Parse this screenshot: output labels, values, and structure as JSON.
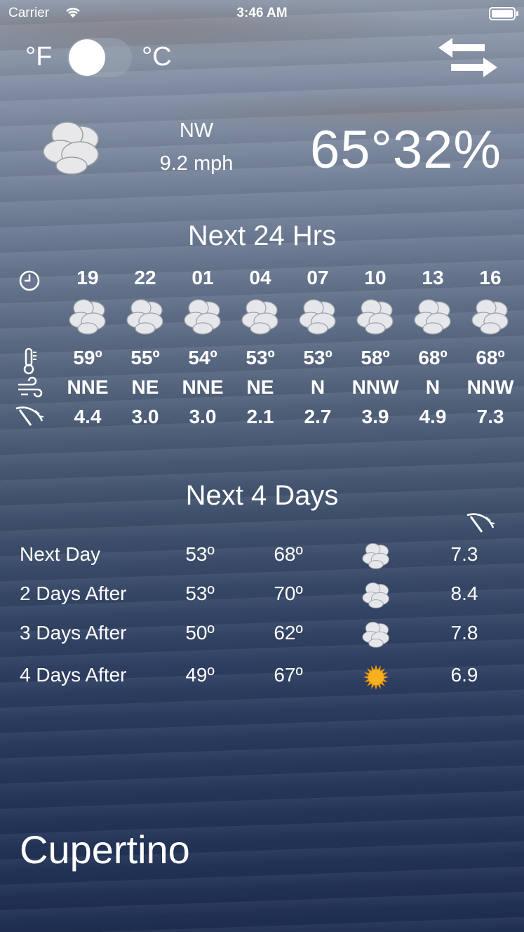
{
  "status_bar": {
    "carrier": "Carrier",
    "time": "3:46 AM"
  },
  "units": {
    "fahrenheit": "°F",
    "celsius": "°C",
    "selected": "fahrenheit"
  },
  "current": {
    "icon": "cloudy-icon",
    "wind_direction": "NW",
    "wind_speed": "9.2 mph",
    "temp_humidity": "65°32%"
  },
  "hourly": {
    "title": "Next 24 Hrs",
    "hours": [
      "19",
      "22",
      "01",
      "04",
      "07",
      "10",
      "13",
      "16"
    ],
    "temps": [
      "59º",
      "55º",
      "54º",
      "53º",
      "53º",
      "58º",
      "68º",
      "68º"
    ],
    "wind_dirs": [
      "NNE",
      "NE",
      "NNE",
      "NE",
      "N",
      "NNW",
      "N",
      "NNW"
    ],
    "wind_speeds": [
      "4.4",
      "3.0",
      "3.0",
      "2.1",
      "2.7",
      "3.9",
      "4.9",
      "7.3"
    ]
  },
  "daily": {
    "title": "Next 4 Days",
    "days": [
      {
        "label": "Next Day",
        "low": "53º",
        "high": "68º",
        "icon": "cloudy-icon",
        "wind": "7.3"
      },
      {
        "label": "2 Days After",
        "low": "53º",
        "high": "70º",
        "icon": "cloudy-icon",
        "wind": "8.4"
      },
      {
        "label": "3 Days After",
        "low": "50º",
        "high": "62º",
        "icon": "cloudy-icon",
        "wind": "7.8"
      },
      {
        "label": "4 Days After",
        "low": "49º",
        "high": "67º",
        "icon": "sun-icon",
        "wind": "6.9"
      }
    ]
  },
  "city": "Cupertino"
}
